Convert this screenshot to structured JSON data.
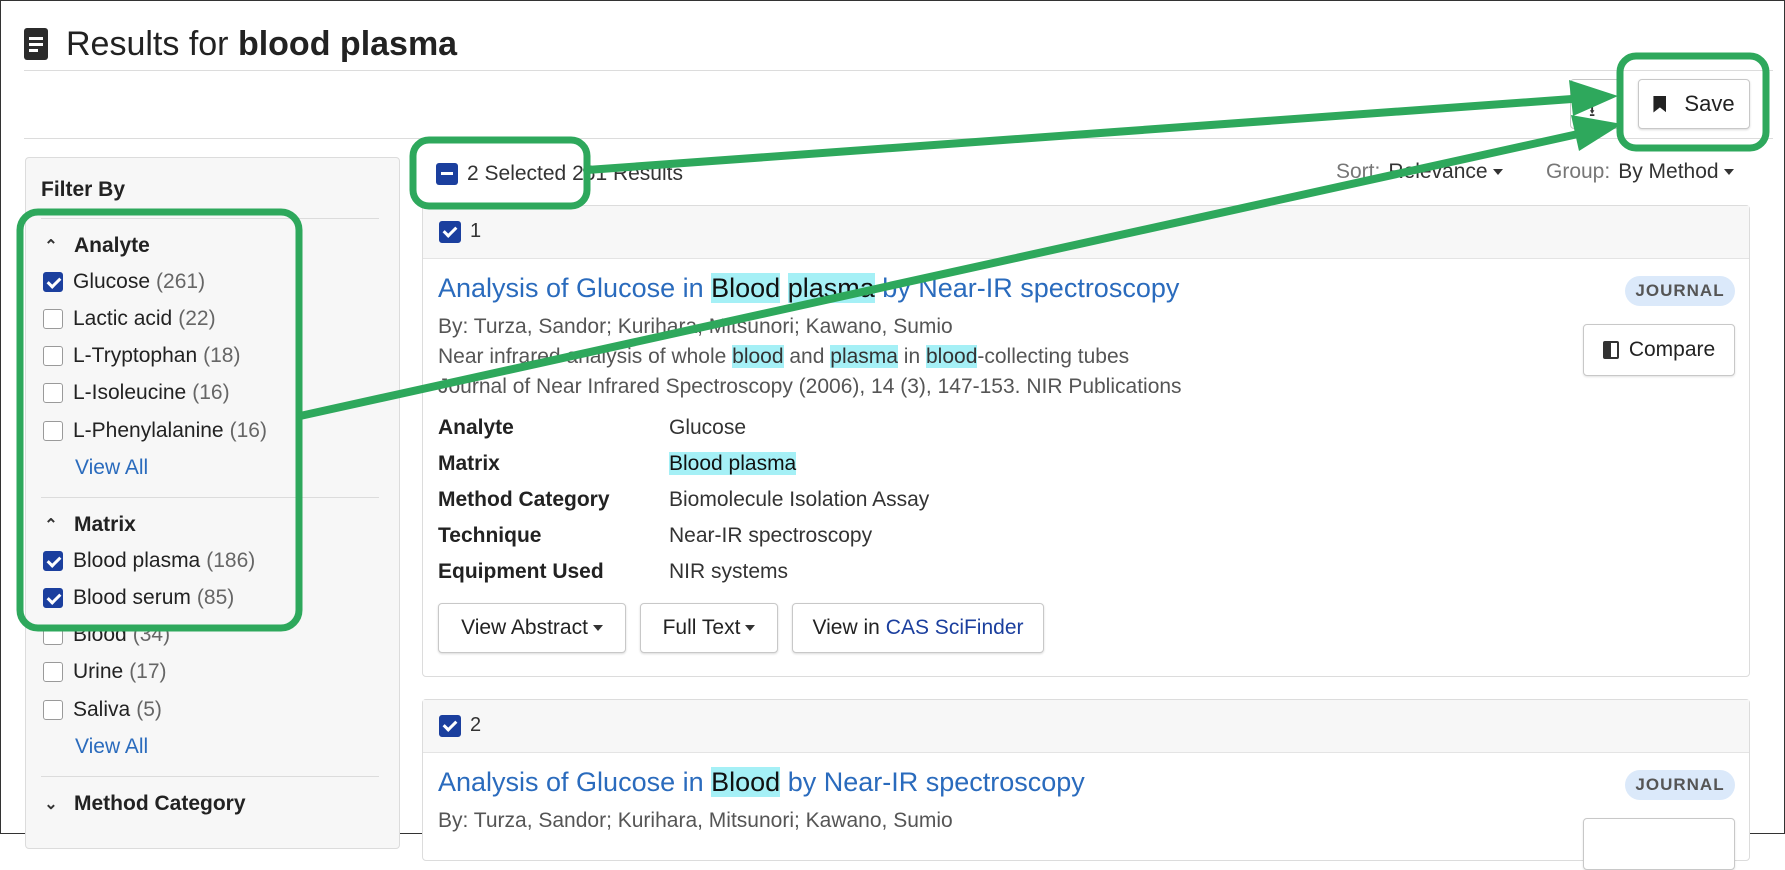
{
  "header": {
    "title_prefix": "Results for",
    "title_query": "blood plasma"
  },
  "toolbar": {
    "save_label": "Save"
  },
  "sidebar": {
    "filter_by": "Filter By",
    "view_all": "View All",
    "analyte": {
      "label": "Analyte",
      "items": [
        {
          "label": "Glucose",
          "count": "(261)",
          "checked": true
        },
        {
          "label": "Lactic acid",
          "count": "(22)",
          "checked": false
        },
        {
          "label": "L-Tryptophan",
          "count": "(18)",
          "checked": false
        },
        {
          "label": "L-Isoleucine",
          "count": "(16)",
          "checked": false
        },
        {
          "label": "L-Phenylalanine",
          "count": "(16)",
          "checked": false
        }
      ]
    },
    "matrix": {
      "label": "Matrix",
      "items": [
        {
          "label": "Blood plasma",
          "count": "(186)",
          "checked": true
        },
        {
          "label": "Blood serum",
          "count": "(85)",
          "checked": true
        },
        {
          "label": "Blood",
          "count": "(34)",
          "checked": false
        },
        {
          "label": "Urine",
          "count": "(17)",
          "checked": false
        },
        {
          "label": "Saliva",
          "count": "(5)",
          "checked": false
        }
      ]
    },
    "method_category": {
      "label": "Method Category"
    }
  },
  "results_bar": {
    "selected": "2 Selected",
    "total": "261 Results",
    "sort_label": "Sort:",
    "sort_value": "Relevance",
    "group_label": "Group:",
    "group_value": "By Method"
  },
  "results": [
    {
      "number": "1",
      "title_parts": [
        "Analysis of Glucose in ",
        "Blood",
        " ",
        "plasma",
        " by Near-IR spectroscopy"
      ],
      "badge": "JOURNAL",
      "compare": "Compare",
      "authors": "By: Turza, Sandor; Kurihara, Mitsunori; Kawano, Sumio",
      "subtitle_parts": [
        "Near infrared analysis of whole ",
        "blood",
        " and ",
        "plasma",
        " in ",
        "blood",
        "-collecting tubes"
      ],
      "source": "Journal of Near Infrared Spectroscopy (2006), 14 (3), 147-153. NIR Publications",
      "fields": [
        {
          "label": "Analyte",
          "value": "Glucose"
        },
        {
          "label": "Matrix",
          "value": "Blood plasma"
        },
        {
          "label": "Method Category",
          "value": "Biomolecule Isolation Assay"
        },
        {
          "label": "Technique",
          "value": "Near-IR spectroscopy"
        },
        {
          "label": "Equipment Used",
          "value": "NIR systems"
        }
      ],
      "actions": {
        "view_abstract": "View Abstract",
        "full_text": "Full Text",
        "view_in": "View in",
        "brand": "CAS SciFinder"
      }
    },
    {
      "number": "2",
      "title_parts": [
        "Analysis of Glucose in ",
        "Blood",
        " by Near-IR spectroscopy"
      ],
      "badge": "JOURNAL",
      "authors": "By: Turza, Sandor; Kurihara, Mitsunori; Kawano, Sumio"
    }
  ],
  "colors": {
    "annotation": "#2ea85c",
    "checkbox": "#1b3f9e",
    "link": "#2a6bbd",
    "highlight": "#a5f0f6"
  }
}
